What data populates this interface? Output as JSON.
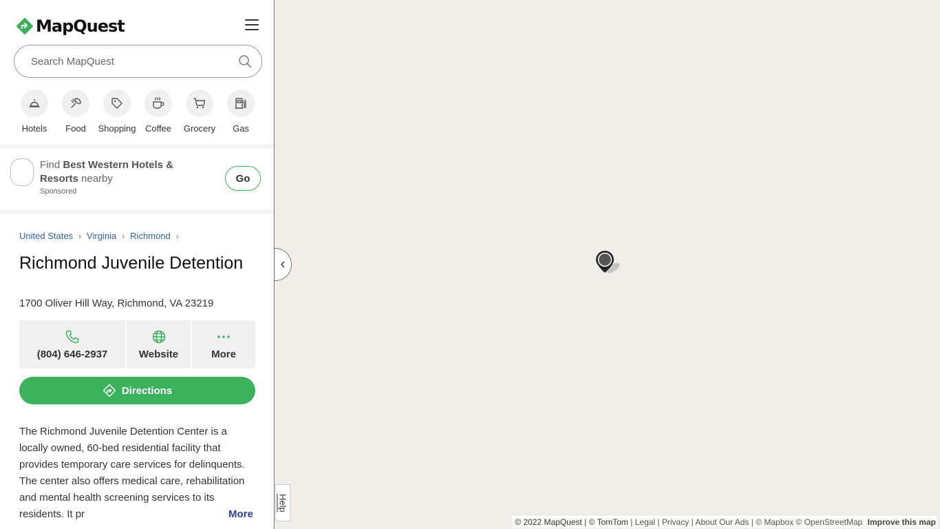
{
  "header": {
    "logo_text": "MapQuest"
  },
  "search": {
    "placeholder": "Search MapQuest"
  },
  "categories": [
    {
      "label": "Hotels",
      "icon": "hotel-bell-icon"
    },
    {
      "label": "Food",
      "icon": "utensils-icon"
    },
    {
      "label": "Shopping",
      "icon": "tag-icon"
    },
    {
      "label": "Coffee",
      "icon": "coffee-cup-icon"
    },
    {
      "label": "Grocery",
      "icon": "cart-icon"
    },
    {
      "label": "Gas",
      "icon": "gas-pump-icon"
    }
  ],
  "sponsor": {
    "prefix": "Find",
    "brand": "Best Western Hotels & Resorts",
    "suffix": "nearby",
    "sponsored_label": "Sponsored",
    "go_label": "Go"
  },
  "breadcrumb": [
    "United States",
    "Virginia",
    "Richmond"
  ],
  "place": {
    "title": "Richmond Juvenile Detention",
    "address": "1700 Oliver Hill Way, Richmond, VA 23219",
    "phone": "(804) 646-2937",
    "website_label": "Website",
    "more_label": "More",
    "directions_label": "Directions",
    "description": "The Richmond Juvenile Detention Center is a locally owned, 60-bed residential facility that provides temporary care services for delinquents. The center also offers medical care, rehabilitation and mental health screening services to its residents. It pr",
    "description_more": "More"
  },
  "map": {
    "help_label": "Help",
    "attribution": {
      "copyright": "© 2022 MapQuest | © TomTom",
      "links": [
        "Legal",
        "Privacy",
        "About Our Ads"
      ],
      "providers": "© Mapbox © OpenStreetMap",
      "improve": "Improve this map"
    }
  },
  "colors": {
    "brand_green": "#3cb15c",
    "link_blue": "#2f5fa8",
    "map_bg": "#efeee9"
  }
}
